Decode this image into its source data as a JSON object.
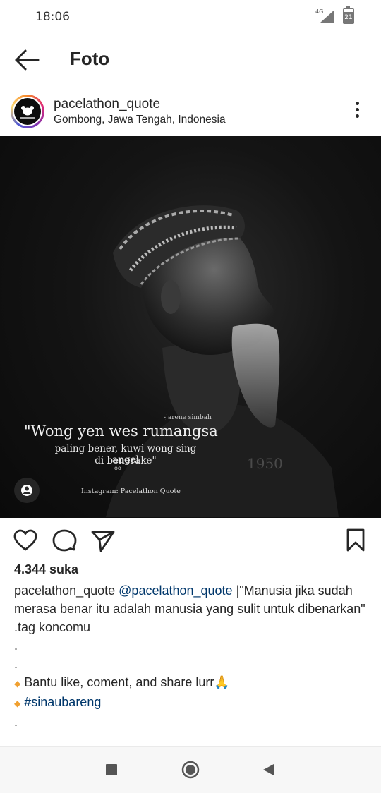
{
  "status": {
    "time": "18:06",
    "network": "4G",
    "battery": "21"
  },
  "appbar": {
    "title": "Foto"
  },
  "post": {
    "username": "pacelathon_quote",
    "location": "Gombong, Jawa Tengah, Indonesia",
    "image": {
      "quote_author": "-jarene simbah",
      "quote_line1": "\"Wong yen wes rumangsa",
      "quote_line2": "paling bener, kuwi wong sing angel",
      "quote_line3": "di benerake\"",
      "quote_dots": "oo",
      "instagram_label": "Instagram: Pacelathon Quote",
      "year": "1950"
    },
    "likes": "4.344 suka",
    "caption": {
      "username": "pacelathon_quote",
      "mention": "@pacelathon_quote",
      "text_1": " |\"Manusia jika sudah merasa benar itu adalah manusia yang sulit untuk dibenarkan\"",
      "line_tag": ".tag koncomu",
      "dot_1": ".",
      "dot_2": ".",
      "bullet_1": " Bantu like, coment, and share lurr🙏",
      "hashtag": "#sinaubareng",
      "dot_3": "."
    }
  },
  "icons": {
    "back": "arrow-left-icon",
    "more": "more-vertical-icon",
    "like": "heart-icon",
    "comment": "comment-icon",
    "share": "send-icon",
    "save": "bookmark-icon",
    "tag": "user-tag-icon"
  },
  "colors": {
    "text": "#262626",
    "link": "#00376b",
    "accent_diamond": "#f0a030"
  }
}
